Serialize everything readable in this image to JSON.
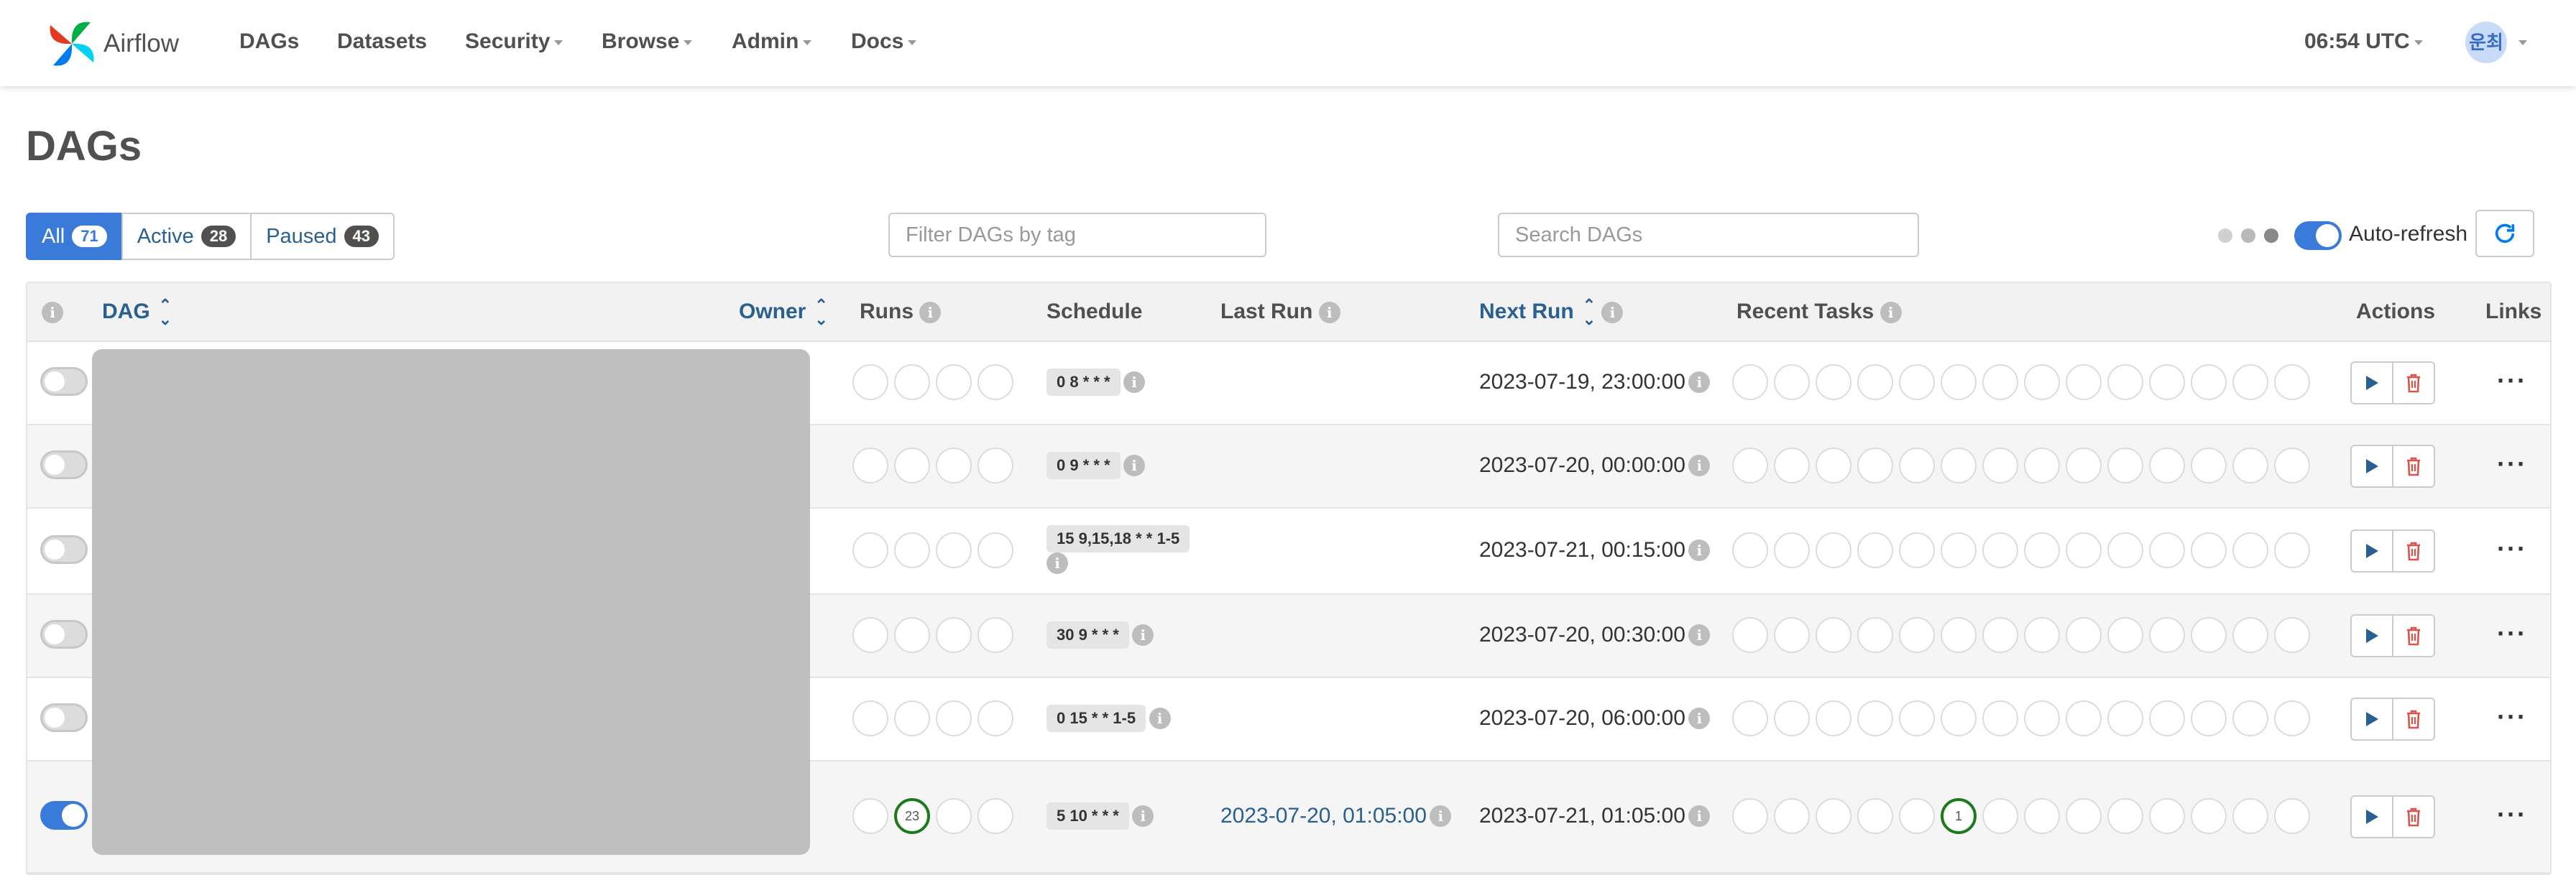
{
  "navbar": {
    "brand": "Airflow",
    "items": [
      {
        "label": "DAGs",
        "dropdown": false
      },
      {
        "label": "Datasets",
        "dropdown": false
      },
      {
        "label": "Security",
        "dropdown": true
      },
      {
        "label": "Browse",
        "dropdown": true
      },
      {
        "label": "Admin",
        "dropdown": true
      },
      {
        "label": "Docs",
        "dropdown": true
      }
    ],
    "time": "06:54 UTC",
    "avatar": "운최"
  },
  "page": {
    "title": "DAGs",
    "filters": [
      {
        "label": "All",
        "count": "71"
      },
      {
        "label": "Active",
        "count": "28"
      },
      {
        "label": "Paused",
        "count": "43"
      }
    ],
    "tag_placeholder": "Filter DAGs by tag",
    "search_placeholder": "Search DAGs",
    "autorefresh_label": "Auto-refresh"
  },
  "table": {
    "columns": {
      "dag": "DAG",
      "owner": "Owner",
      "runs": "Runs",
      "schedule": "Schedule",
      "last_run": "Last Run",
      "next_run": "Next Run",
      "recent_tasks": "Recent Tasks",
      "actions": "Actions",
      "links": "Links"
    },
    "rows": [
      {
        "active": false,
        "schedule": "0 8 * * *",
        "last_run": "",
        "next_run": "2023-07-19, 23:00:00",
        "runs": [
          "",
          "",
          "",
          ""
        ],
        "tasks_success_index": -1,
        "tasks_success_count": ""
      },
      {
        "active": false,
        "schedule": "0 9 * * *",
        "last_run": "",
        "next_run": "2023-07-20, 00:00:00",
        "runs": [
          "",
          "",
          "",
          ""
        ],
        "tasks_success_index": -1,
        "tasks_success_count": ""
      },
      {
        "active": false,
        "schedule": "15 9,15,18 * * 1-5",
        "last_run": "",
        "next_run": "2023-07-21, 00:15:00",
        "runs": [
          "",
          "",
          "",
          ""
        ],
        "tasks_success_index": -1,
        "tasks_success_count": ""
      },
      {
        "active": false,
        "schedule": "30 9 * * *",
        "last_run": "",
        "next_run": "2023-07-20, 00:30:00",
        "runs": [
          "",
          "",
          "",
          ""
        ],
        "tasks_success_index": -1,
        "tasks_success_count": ""
      },
      {
        "active": false,
        "schedule": "0 15 * * 1-5",
        "last_run": "",
        "next_run": "2023-07-20, 06:00:00",
        "runs": [
          "",
          "",
          "",
          ""
        ],
        "tasks_success_index": -1,
        "tasks_success_count": ""
      },
      {
        "active": true,
        "schedule": "5 10 * * *",
        "last_run": "2023-07-20, 01:05:00",
        "next_run": "2023-07-21, 01:05:00",
        "runs": [
          "",
          "23",
          "",
          ""
        ],
        "tasks_success_index": 5,
        "tasks_success_count": "1"
      }
    ]
  },
  "colors": {
    "primary": "#3a7ad9",
    "link": "#2a6090",
    "success": "#1c7a1c",
    "danger": "#d9534f"
  }
}
